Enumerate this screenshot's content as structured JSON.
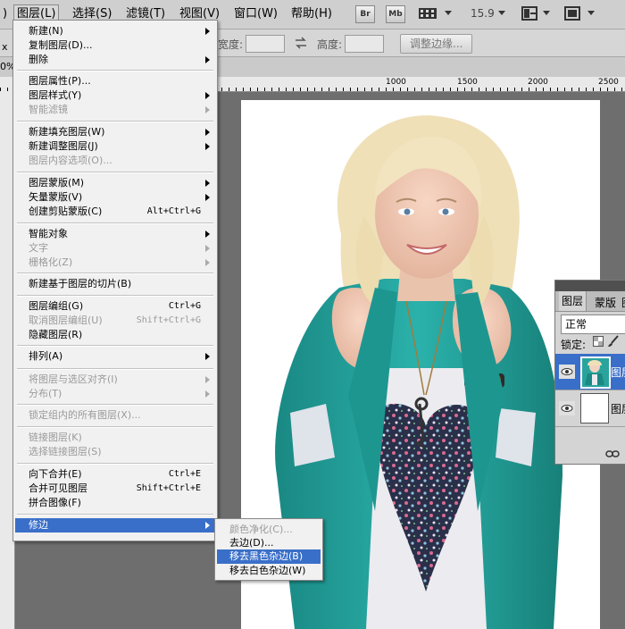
{
  "menubar": {
    "items": [
      {
        "label": ")"
      },
      {
        "label": "图层(L)"
      },
      {
        "label": "选择(S)"
      },
      {
        "label": "滤镜(T)"
      },
      {
        "label": "视图(V)"
      },
      {
        "label": "窗口(W)"
      },
      {
        "label": "帮助(H)"
      }
    ],
    "br_label": "Br",
    "mb_label": "Mb",
    "zoom_value": "15.9"
  },
  "options": {
    "width_label": "宽度:",
    "height_label": "高度:",
    "refine_edge_label": "调整边缘..."
  },
  "tab": {
    "zoom_fragment": "0%",
    "left_fragment": "x"
  },
  "ruler": {
    "labels": [
      "1000",
      "1500",
      "2000",
      "2500"
    ]
  },
  "menu": {
    "items": [
      {
        "label": "新建(N)",
        "enabled": true,
        "submenu": true
      },
      {
        "label": "复制图层(D)...",
        "enabled": true
      },
      {
        "label": "删除",
        "enabled": true,
        "submenu": true
      },
      {
        "label": "图层属性(P)...",
        "enabled": true
      },
      {
        "label": "图层样式(Y)",
        "enabled": true,
        "submenu": true
      },
      {
        "label": "智能滤镜",
        "enabled": false,
        "submenu": true
      },
      {
        "label": "新建填充图层(W)",
        "enabled": true,
        "submenu": true
      },
      {
        "label": "新建调整图层(J)",
        "enabled": true,
        "submenu": true
      },
      {
        "label": "图层内容选项(O)...",
        "enabled": false
      },
      {
        "label": "图层蒙版(M)",
        "enabled": true,
        "submenu": true
      },
      {
        "label": "矢量蒙版(V)",
        "enabled": true,
        "submenu": true
      },
      {
        "label": "创建剪贴蒙版(C)",
        "enabled": true,
        "shortcut": "Alt+Ctrl+G"
      },
      {
        "label": "智能对象",
        "enabled": true,
        "submenu": true
      },
      {
        "label": "文字",
        "enabled": false,
        "submenu": true
      },
      {
        "label": "栅格化(Z)",
        "enabled": false,
        "submenu": true
      },
      {
        "label": "新建基于图层的切片(B)",
        "enabled": true
      },
      {
        "label": "图层编组(G)",
        "enabled": true,
        "shortcut": "Ctrl+G"
      },
      {
        "label": "取消图层编组(U)",
        "enabled": false,
        "shortcut": "Shift+Ctrl+G"
      },
      {
        "label": "隐藏图层(R)",
        "enabled": true
      },
      {
        "label": "排列(A)",
        "enabled": true,
        "submenu": true
      },
      {
        "label": "将图层与选区对齐(I)",
        "enabled": false,
        "submenu": true
      },
      {
        "label": "分布(T)",
        "enabled": false,
        "submenu": true
      },
      {
        "label": "锁定组内的所有图层(X)...",
        "enabled": false
      },
      {
        "label": "链接图层(K)",
        "enabled": false
      },
      {
        "label": "选择链接图层(S)",
        "enabled": false
      },
      {
        "label": "向下合并(E)",
        "enabled": true,
        "shortcut": "Ctrl+E"
      },
      {
        "label": "合并可见图层",
        "enabled": true,
        "shortcut": "Shift+Ctrl+E"
      },
      {
        "label": "拼合图像(F)",
        "enabled": true
      },
      {
        "label": "修边",
        "enabled": true,
        "submenu": true,
        "highlighted": true
      }
    ]
  },
  "submenu": {
    "items": [
      {
        "label": "颜色净化(C)...",
        "enabled": false
      },
      {
        "label": "去边(D)...",
        "enabled": true
      },
      {
        "label": "移去黑色杂边(B)",
        "enabled": true,
        "highlighted": true
      },
      {
        "label": "移去白色杂边(W)",
        "enabled": true
      }
    ]
  },
  "layers_panel": {
    "tabs": [
      "图层",
      "蒙版",
      "图"
    ],
    "blend_mode": "正常",
    "lock_label": "锁定:",
    "layers": [
      {
        "name": "图层",
        "selected": true
      },
      {
        "name": "图层",
        "selected": false
      }
    ]
  },
  "colors": {
    "highlight": "#3a6fc9",
    "menu_bg": "#f1f1f1",
    "jacket": "#1f9a95"
  }
}
